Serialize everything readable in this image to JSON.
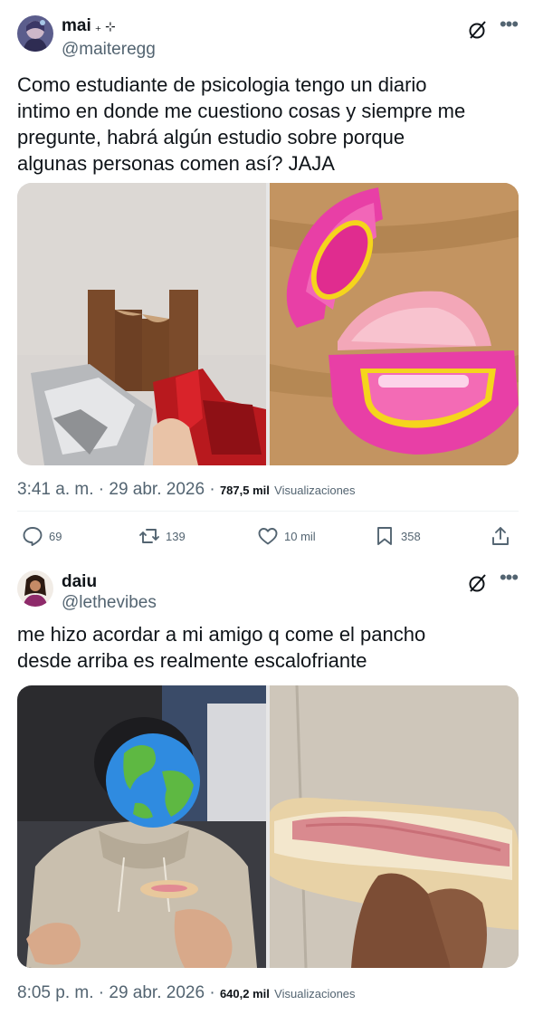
{
  "tweets": [
    {
      "display_name": "mai",
      "name_decoration": "₊ ⊹",
      "handle": "@maiteregg",
      "text": "Como estudiante de psicologia tengo un diario\nintimo en donde me cuestiono cosas y siempre me\npregunte, habrá algún estudio sobre porque\nalgunas personas comen así? JAJA",
      "time": "3:41 a. m.",
      "date": "29 abr. 2026",
      "views_count": "787,5 mil",
      "views_label": "Visualizaciones",
      "replies": "69",
      "reposts": "139",
      "likes": "10 mil",
      "bookmarks": "358",
      "images": [
        "Kit Kat bar with chunk bitten off the top",
        "Hubba Bubba bubble tape with gum eaten from the outside"
      ]
    },
    {
      "display_name": "daiu",
      "handle": "@lethevibes",
      "text": "me hizo acordar a mi amigo q come el pancho\ndesde arriba es realmente escalofriante",
      "time": "8:05 p. m.",
      "date": "29 abr. 2026",
      "views_count": "640,2 mil",
      "views_label": "Visualizaciones",
      "images": [
        "Person with earth emoji over face holding a hot dog",
        "Close-up of hot dog bun eaten from the top"
      ]
    }
  ],
  "icons": {
    "grok": "grok-icon",
    "more": "more-icon",
    "reply": "reply-icon",
    "repost": "repost-icon",
    "like": "heart-icon",
    "bookmark": "bookmark-icon",
    "share": "share-icon"
  },
  "colors": {
    "text_primary": "#0f1419",
    "text_secondary": "#536471",
    "divider": "#eff3f4"
  }
}
